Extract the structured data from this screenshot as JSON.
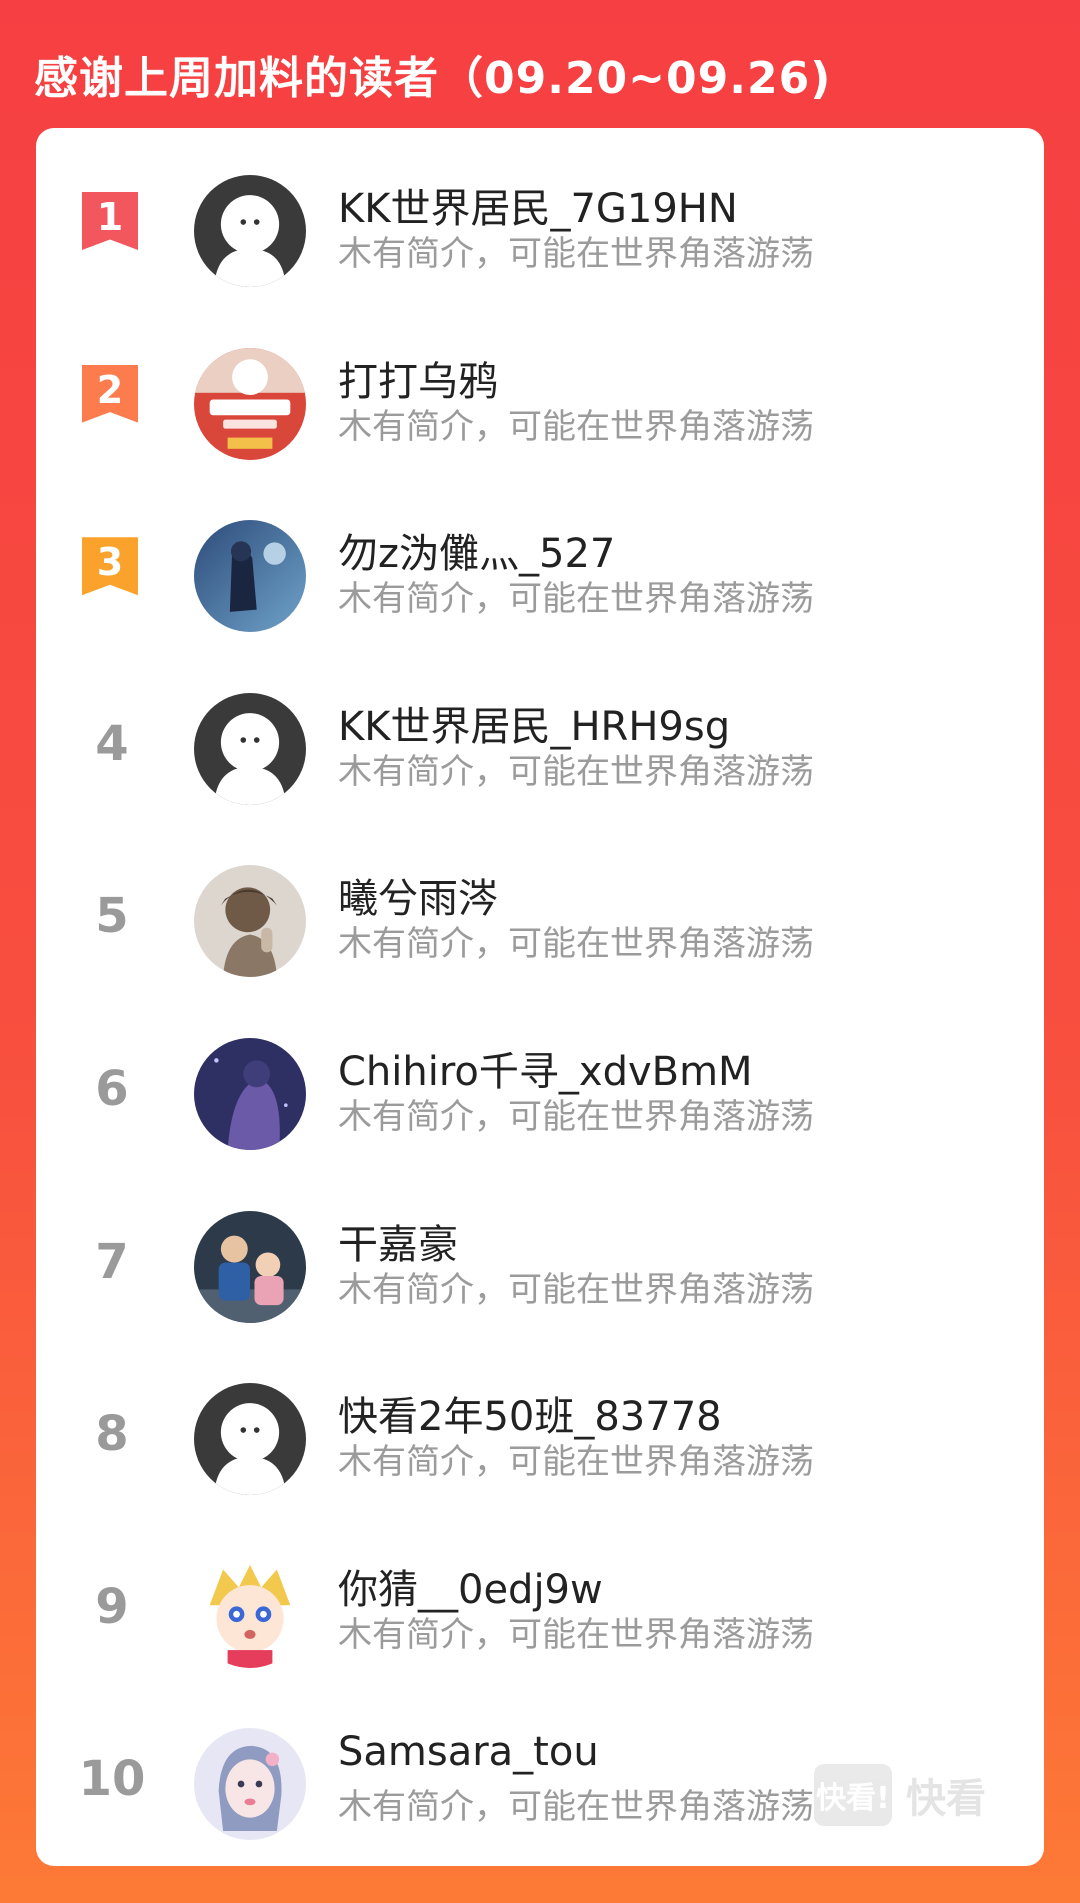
{
  "header": {
    "title": "感谢上周加料的读者（09.20~09.26)"
  },
  "readers": [
    {
      "rank": "1",
      "name": "KK世界居民_7G19HN",
      "bio": "木有简介，可能在世界角落游荡",
      "badge_color": "#f2575e",
      "avatar": "default"
    },
    {
      "rank": "2",
      "name": "打打乌鸦",
      "bio": "木有简介，可能在世界角落游荡",
      "badge_color": "#fd7c4d",
      "avatar": "cartoon"
    },
    {
      "rank": "3",
      "name": "勿z沩儺灬_527",
      "bio": "木有简介，可能在世界角落游荡",
      "badge_color": "#fba22c",
      "avatar": "night"
    },
    {
      "rank": "4",
      "name": "KK世界居民_HRH9sg",
      "bio": "木有简介，可能在世界角落游荡",
      "badge_color": "",
      "avatar": "default"
    },
    {
      "rank": "5",
      "name": "曦兮雨涔",
      "bio": "木有简介，可能在世界角落游荡",
      "badge_color": "",
      "avatar": "girl-beige"
    },
    {
      "rank": "6",
      "name": "Chihiro千寻_xdvBmM",
      "bio": "木有简介，可能在世界角落游荡",
      "badge_color": "",
      "avatar": "anime-purple"
    },
    {
      "rank": "7",
      "name": "干嘉豪",
      "bio": "木有简介，可能在世界角落游荡",
      "badge_color": "",
      "avatar": "kids-photo"
    },
    {
      "rank": "8",
      "name": "快看2年50班_83778",
      "bio": "木有简介，可能在世界角落游荡",
      "badge_color": "",
      "avatar": "default"
    },
    {
      "rank": "9",
      "name": "你猜__0edj9w",
      "bio": "木有简介，可能在世界角落游荡",
      "badge_color": "",
      "avatar": "anime-blonde"
    },
    {
      "rank": "10",
      "name": "Samsara_tou",
      "bio": "木有简介，可能在世界角落游荡",
      "badge_color": "",
      "avatar": "girl-pink"
    }
  ],
  "watermark": {
    "logo": "快看!",
    "text": "快看"
  }
}
